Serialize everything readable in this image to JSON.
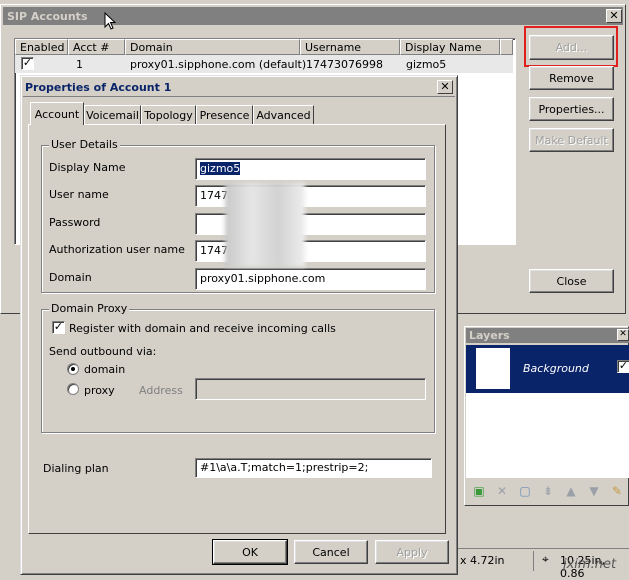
{
  "sip_window": {
    "title": "SIP Accounts",
    "columns": [
      "Enabled",
      "Acct #",
      "Domain",
      "Username",
      "Display Name"
    ],
    "rows": [
      {
        "enabled": "✓",
        "acct": "1",
        "domain": "proxy01.sipphone.com (default)",
        "username": "17473076998",
        "display_name": "gizmo5"
      }
    ],
    "buttons": {
      "add": "Add...",
      "remove": "Remove",
      "properties": "Properties...",
      "make_default": "Make Default",
      "close": "Close"
    }
  },
  "dialog": {
    "title": "Properties of Account 1",
    "tabs": [
      "Account",
      "Voicemail",
      "Topology",
      "Presence",
      "Advanced"
    ],
    "user_details": {
      "group_title": "User Details",
      "display_name_label": "Display Name",
      "display_name_value": "gizmo5",
      "user_name_label": "User name",
      "user_name_value": "1747",
      "password_label": "Password",
      "auth_user_label": "Authorization user name",
      "auth_user_value": "1747",
      "domain_label": "Domain",
      "domain_value": "proxy01.sipphone.com"
    },
    "domain_proxy": {
      "group_title": "Domain Proxy",
      "register_label": "Register with domain and receive incoming calls",
      "register_checked": true,
      "send_outbound_label": "Send outbound via:",
      "domain_option": "domain",
      "proxy_option": "proxy",
      "address_label": "Address",
      "selected": "domain"
    },
    "dialing_plan_label": "Dialing plan",
    "dialing_plan_value": "#1\\a\\a.T;match=1;prestrip=2;",
    "buttons": {
      "ok": "OK",
      "cancel": "Cancel",
      "apply": "Apply"
    }
  },
  "layers_panel": {
    "title": "Layers",
    "layer_name": "Background",
    "toolbar_icons": [
      "new-layer-icon",
      "delete-layer-icon",
      "duplicate-layer-icon",
      "merge-down-icon",
      "move-up-icon",
      "move-down-icon",
      "properties-icon"
    ]
  },
  "status_bar": {
    "width": "x 4.72in",
    "position": "10.25in, 0.86"
  },
  "watermark": "jxim.net",
  "colors": {
    "highlight_box": "#e0201c",
    "selection": "#0a246a",
    "layers_bg": "#0a246a"
  }
}
